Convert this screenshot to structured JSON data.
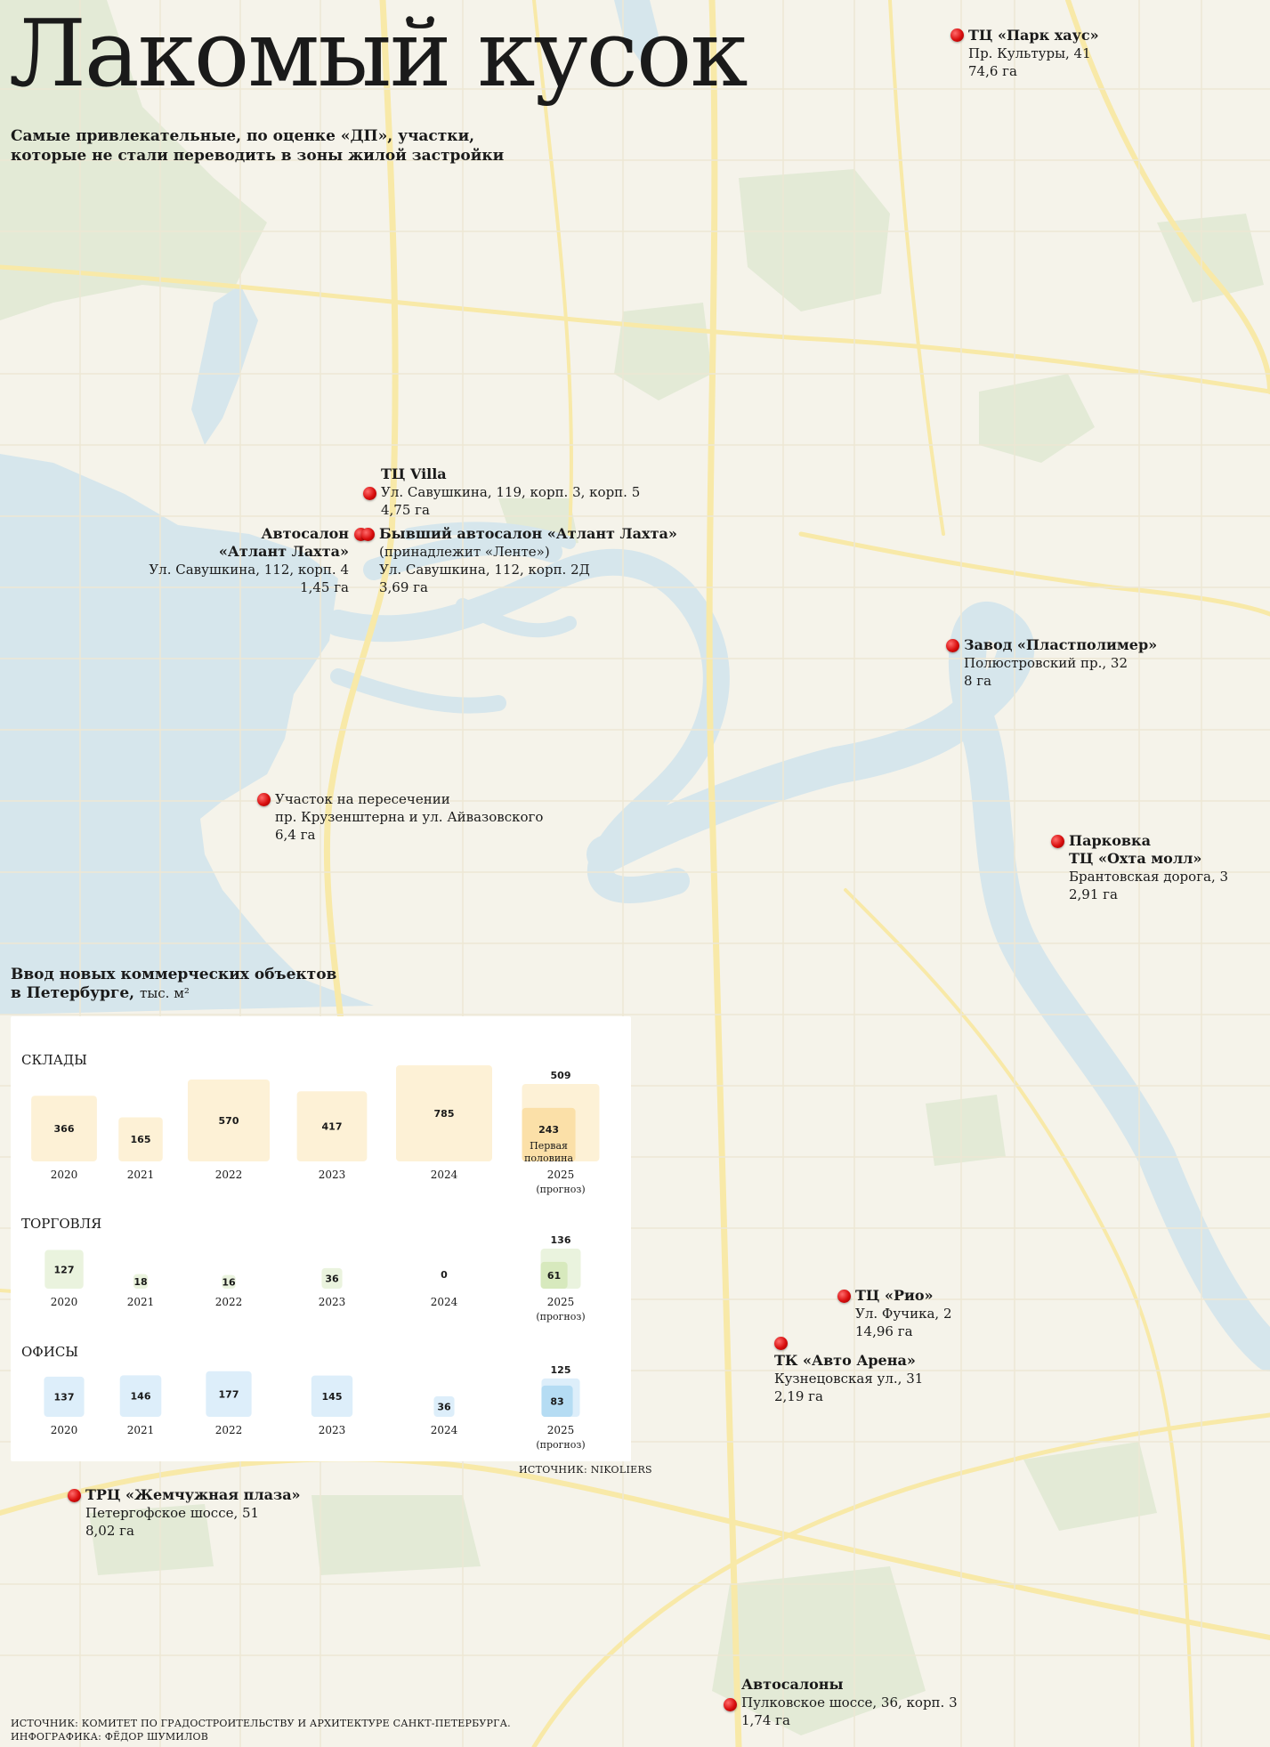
{
  "title": "Лакомый кусок",
  "subtitle_lines": [
    "Самые привлекательные, по оценке «ДП», участки,",
    "которые не стали переводить в зоны жилой застройки"
  ],
  "colors": {
    "marker": "#d80d0d",
    "water": "#d6e6ec",
    "land": "#f5f3ea",
    "roads": "#f8e9a8",
    "parks": "#e3ead6",
    "warehouse": "#fdf1d6",
    "warehouse_dark": "#fbe0a8",
    "retail": "#eaf3de",
    "retail_dark": "#d7e9bd",
    "office": "#ddeefa",
    "office_dark": "#b5dcf3"
  },
  "locations": [
    {
      "name": "ТЦ «Парк хаус»",
      "address": "Пр. Культуры, 41",
      "area": "74,6 га"
    },
    {
      "name": "ТЦ Villa",
      "address": "Ул. Савушкина, 119, корп. 3, корп. 5",
      "area": "4,75 га"
    },
    {
      "name": "Автосалон\n«Атлант Лахта»",
      "address": "Ул. Савушкина, 112, корп. 4",
      "area": "1,45 га"
    },
    {
      "name": "Бывший автосалон «Атлант Лахта»",
      "note": "(принадлежит «Ленте»)",
      "address": "Ул. Савушкина, 112, корп. 2Д",
      "area": "3,69 га"
    },
    {
      "name": "Завод «Пластполимер»",
      "address": "Полюстровский пр., 32",
      "area": "8 га"
    },
    {
      "name": "Участок на пересечении\nпр. Крузенштерна и ул. Айвазовского",
      "address": "",
      "area": "6,4 га"
    },
    {
      "name": "Парковка\nТЦ «Охта молл»",
      "address": "Брантовская дорога, 3",
      "area": "2,91 га"
    },
    {
      "name": "ТЦ «Рио»",
      "address": "Ул. Фучика, 2",
      "area": "14,96 га"
    },
    {
      "name": "ТК «Авто Арена»",
      "address": "Кузнецовская ул., 31",
      "area": "2,19 га"
    },
    {
      "name": "ТРЦ «Жемчужная плаза»",
      "address": "Петергофское шоссе, 51",
      "area": "8,02 га"
    },
    {
      "name": "Автосалоны",
      "address": "Пулковское шоссе, 36, корп. 3",
      "area": "1,74 га"
    }
  ],
  "chart_data": {
    "type": "bar",
    "title": "Ввод новых коммерческих объектов",
    "title_line2": "в Петербурге,",
    "unit": "тыс. м²",
    "categories": [
      "2020",
      "2021",
      "2022",
      "2023",
      "2024",
      "2025"
    ],
    "forecast_note": "(прогноз)",
    "series": [
      {
        "name": "СКЛАДЫ",
        "values": [
          366,
          165,
          570,
          417,
          785,
          509
        ],
        "first_half_2025": 243,
        "first_half_label": "Первая половина"
      },
      {
        "name": "ТОРГОВЛЯ",
        "values": [
          127,
          18,
          16,
          36,
          0,
          136
        ],
        "first_half_2025": 61
      },
      {
        "name": "ОФИСЫ",
        "values": [
          137,
          146,
          177,
          145,
          36,
          125
        ],
        "first_half_2025": 83
      }
    ],
    "source": "ИСТОЧНИК: NIKOLIERS"
  },
  "footer": [
    "ИСТОЧНИК: КОМИТЕТ ПО ГРАДОСТРОИТЕЛЬСТВУ И АРХИТЕКТУРЕ САНКТ-ПЕТЕРБУРГА.",
    "ИНФОГРАФИКА: ФЁДОР ШУМИЛОВ"
  ]
}
